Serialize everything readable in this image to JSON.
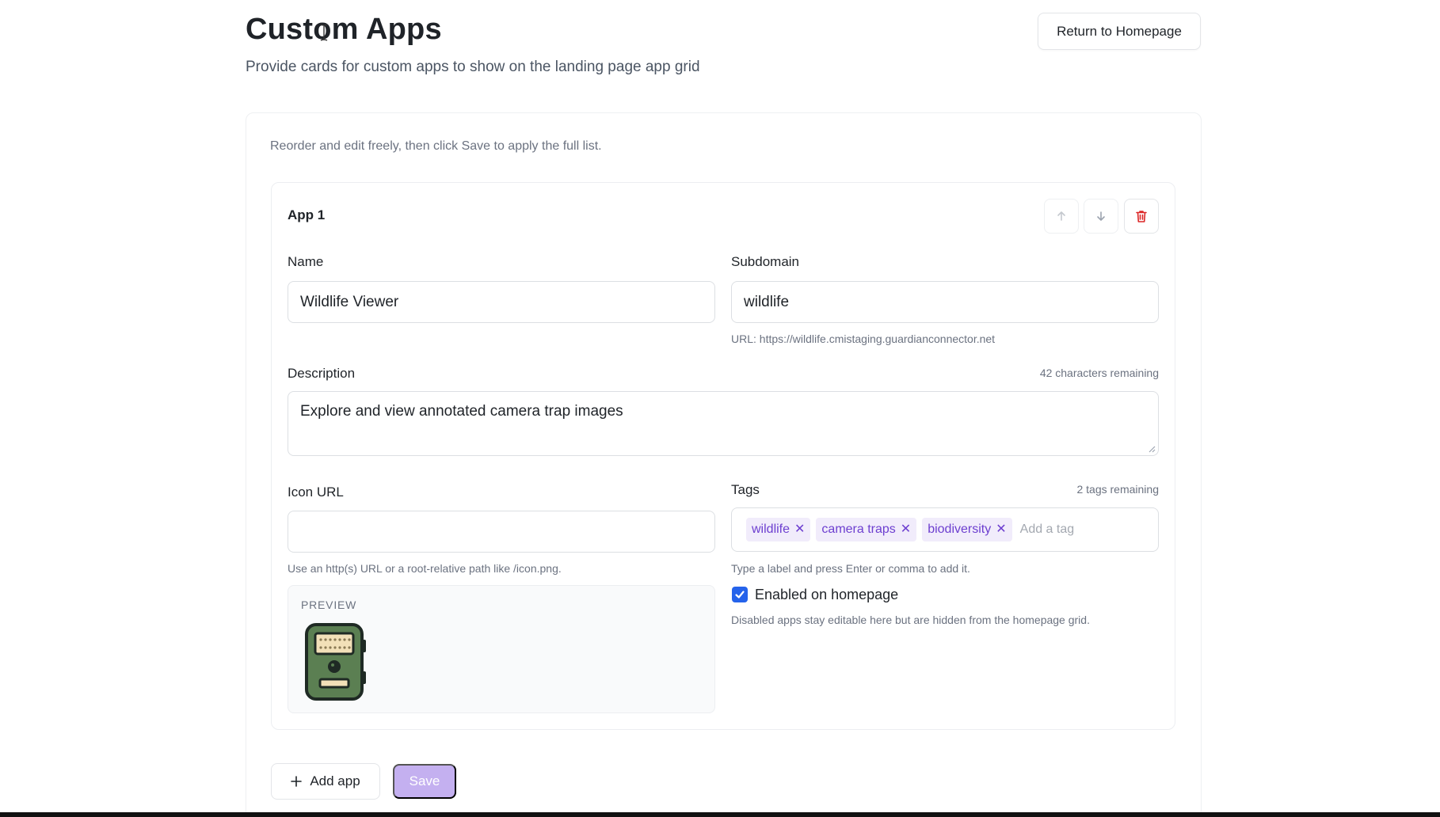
{
  "header": {
    "title": "Custom Apps",
    "subtitle": "Provide cards for custom apps to show on the landing page app grid",
    "return_button": "Return to Homepage"
  },
  "panel": {
    "hint": "Reorder and edit freely, then click Save to apply the full list."
  },
  "app": {
    "title": "App 1",
    "name_label": "Name",
    "name_value": "Wildlife Viewer",
    "subdomain_label": "Subdomain",
    "subdomain_value": "wildlife",
    "url_help": "URL: https://wildlife.cmistaging.guardianconnector.net",
    "description_label": "Description",
    "description_counter": "42 characters remaining",
    "description_value": "Explore and view annotated camera trap images",
    "icon_url_label": "Icon URL",
    "icon_url_value": "",
    "icon_url_help": "Use an http(s) URL or a root-relative path like /icon.png.",
    "preview_label": "PREVIEW",
    "tags_label": "Tags",
    "tags_counter": "2 tags remaining",
    "tags": [
      "wildlife",
      "camera traps",
      "biodiversity"
    ],
    "tag_remove_glyph": "✕",
    "tag_placeholder": "Add a tag",
    "tags_help": "Type a label and press Enter or comma to add it.",
    "enabled_label": "Enabled on homepage",
    "enabled": true,
    "enabled_help": "Disabled apps stay editable here but are hidden from the homepage grid."
  },
  "icons": {
    "move_up": "arrow-up-icon",
    "move_down": "arrow-down-icon",
    "delete": "trash-icon",
    "add": "plus-icon",
    "preview": "camera-trap-icon"
  },
  "footer": {
    "add_label": "Add app",
    "save_label": "Save"
  },
  "colors": {
    "accent": "#6d3fd0",
    "tag_bg": "#f1ecfb",
    "save_disabled": "#c4b0f0",
    "delete_red": "#dc2626",
    "checkbox": "#2563eb"
  }
}
